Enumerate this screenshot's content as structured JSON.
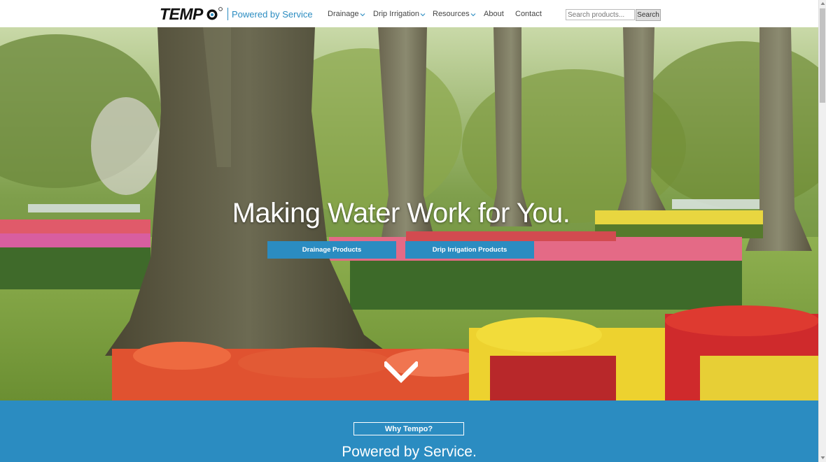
{
  "header": {
    "logo_text": "TEMPO",
    "tagline": "Powered by Service",
    "nav": [
      {
        "label": "Drainage",
        "has_dropdown": true
      },
      {
        "label": "Drip Irrigation",
        "has_dropdown": true
      },
      {
        "label": "Resources",
        "has_dropdown": true
      },
      {
        "label": "About",
        "has_dropdown": false
      },
      {
        "label": "Contact",
        "has_dropdown": false
      }
    ],
    "search": {
      "placeholder": "Search products...",
      "value": "",
      "button_label": "Search"
    }
  },
  "hero": {
    "title": "Making Water Work for You.",
    "buttons": [
      "Drainage Products",
      "Drip Irrigation Products"
    ],
    "scroll_icon": "chevron-down-icon"
  },
  "band": {
    "button_label": "Why Tempo?",
    "title": "Powered by Service."
  },
  "colors": {
    "brand_blue": "#2b8cc1",
    "nav_text": "#444444",
    "white": "#ffffff"
  }
}
